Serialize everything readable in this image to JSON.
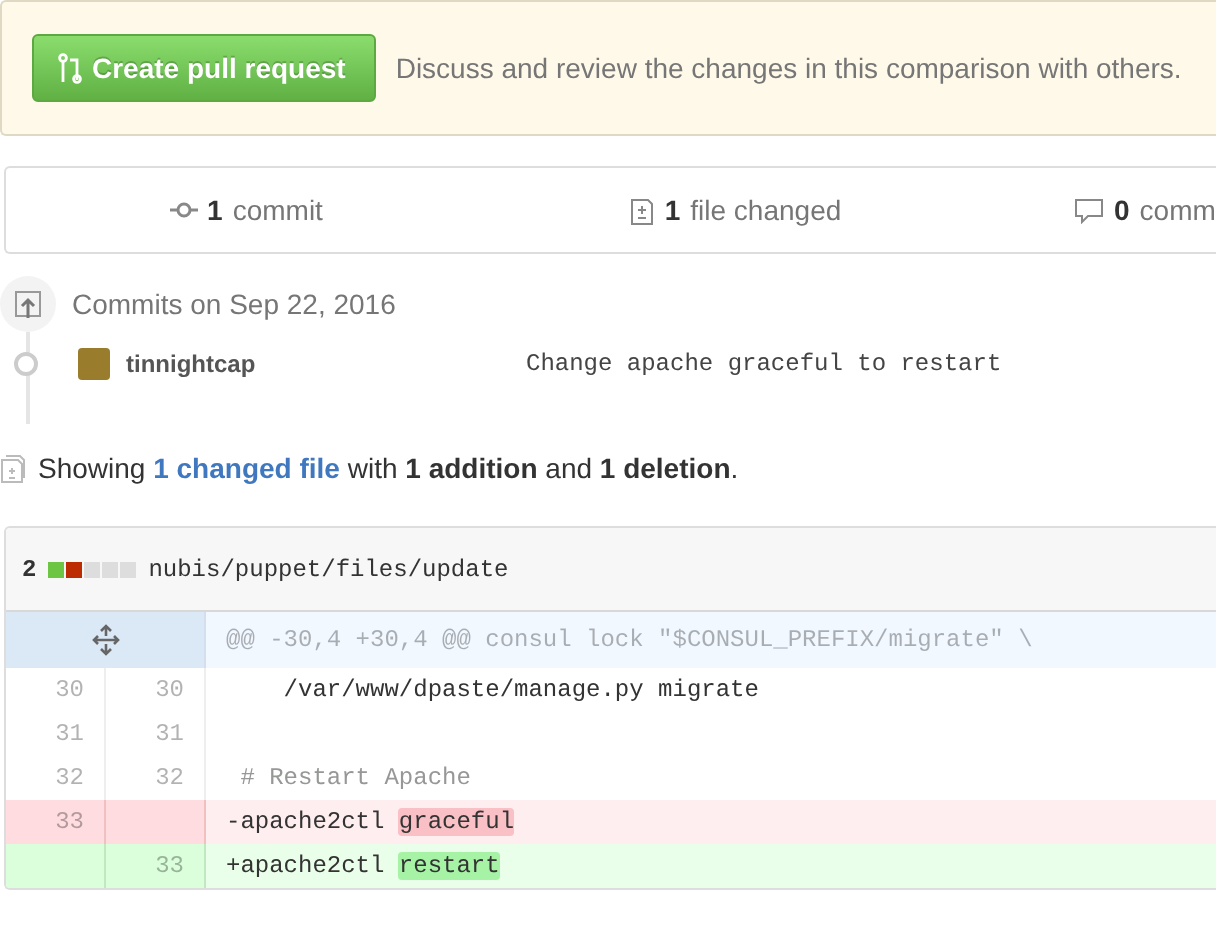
{
  "banner": {
    "button": "Create pull request",
    "message": "Discuss and review the changes in this comparison with others."
  },
  "stats": [
    {
      "kind": "commit",
      "count": "1",
      "label": "commit"
    },
    {
      "kind": "file",
      "count": "1",
      "label": "file changed"
    },
    {
      "kind": "comment",
      "count": "0",
      "label": "comm"
    }
  ],
  "commits": {
    "heading": "Commits on Sep 22, 2016",
    "items": [
      {
        "author": "tinnightcap",
        "message": "Change apache graceful to restart"
      }
    ]
  },
  "summary": {
    "prefix": "Showing",
    "link": "1 changed file",
    "rest": "with **1 addition** and **1 deletion**."
  },
  "file": {
    "changes": "2",
    "diffstat": [
      {
        "kind": "added"
      },
      {
        "kind": "deleted"
      },
      {
        "kind": "neutral"
      },
      {
        "kind": "neutral"
      },
      {
        "kind": "neutral"
      }
    ],
    "path": "nubis/puppet/files/update",
    "hunk": "@@ -30,4 +30,4 @@ consul lock \"$CONSUL_PREFIX/migrate\" \\",
    "lines": [
      {
        "kind": "context",
        "old": "30",
        "new": "30",
        "code": "    /var/www/dpaste/manage.py migrate"
      },
      {
        "kind": "context",
        "old": "31",
        "new": "31"
      },
      {
        "kind": "context",
        "old": "32",
        "new": "32",
        "code": " # Restart Apache",
        "comment": true
      },
      {
        "kind": "deletion",
        "old": "33",
        "code": "-apache2ctl ",
        "highlight": "graceful"
      },
      {
        "kind": "addition",
        "new": "33",
        "code": "+apache2ctl ",
        "highlight": "restart"
      }
    ]
  }
}
